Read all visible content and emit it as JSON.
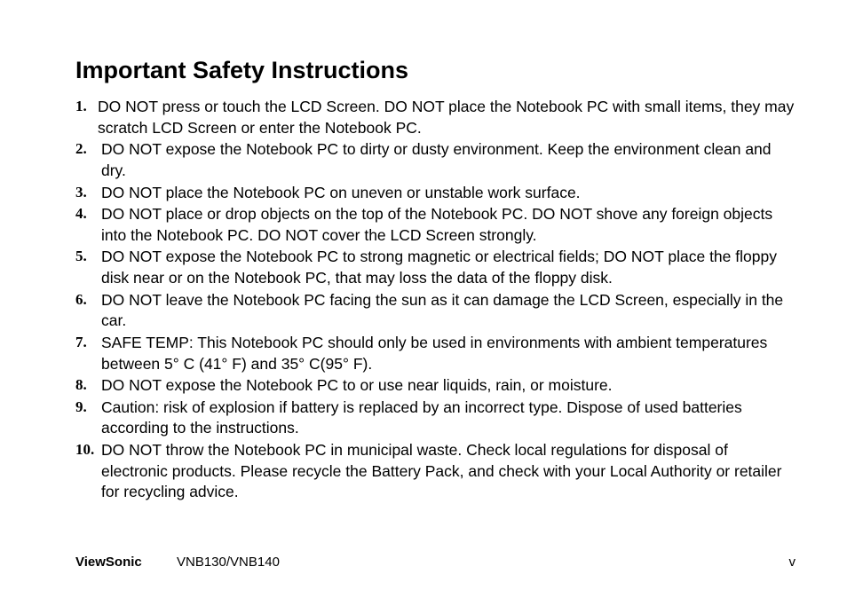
{
  "title": "Important Safety Instructions",
  "items": [
    {
      "num": "1.",
      "text": "DO NOT press or touch the LCD Screen. DO NOT place the Notebook PC with small items, they may scratch LCD Screen or enter the Notebook PC."
    },
    {
      "num": "2.",
      "text": "DO NOT expose the Notebook PC to dirty or dusty environment. Keep the environment clean and dry."
    },
    {
      "num": "3.",
      "text": "DO NOT place the Notebook PC on uneven or unstable work surface."
    },
    {
      "num": "4.",
      "text": "DO NOT place or drop objects on the top of the Notebook PC. DO NOT shove any foreign objects into the Notebook PC. DO NOT cover the LCD Screen strongly."
    },
    {
      "num": "5.",
      "text": "DO NOT expose the Notebook PC to strong magnetic or electrical fields; DO NOT place the floppy disk near or on the Notebook PC, that may loss the data of the floppy disk."
    },
    {
      "num": "6.",
      "text": "DO NOT leave the Notebook PC facing the sun as it can damage the LCD Screen, especially in the car."
    },
    {
      "num": "7.",
      "text": "SAFE TEMP: This Notebook PC should only be used in environments with ambient temperatures between 5° C (41° F) and 35° C(95° F)."
    },
    {
      "num": "8.",
      "text": "DO NOT expose the Notebook PC to or use near liquids, rain, or moisture."
    },
    {
      "num": "9.",
      "text": "Caution: risk of explosion if battery is replaced by an incorrect type. Dispose of used batteries according to the instructions."
    },
    {
      "num": "10.",
      "text": "DO NOT throw the Notebook PC in municipal waste. Check local regulations for disposal of electronic products. Please recycle the Battery Pack, and check with your Local Authority or retailer for recycling advice."
    }
  ],
  "footer": {
    "brand": "ViewSonic",
    "model": "VNB130/VNB140",
    "page": "v"
  }
}
